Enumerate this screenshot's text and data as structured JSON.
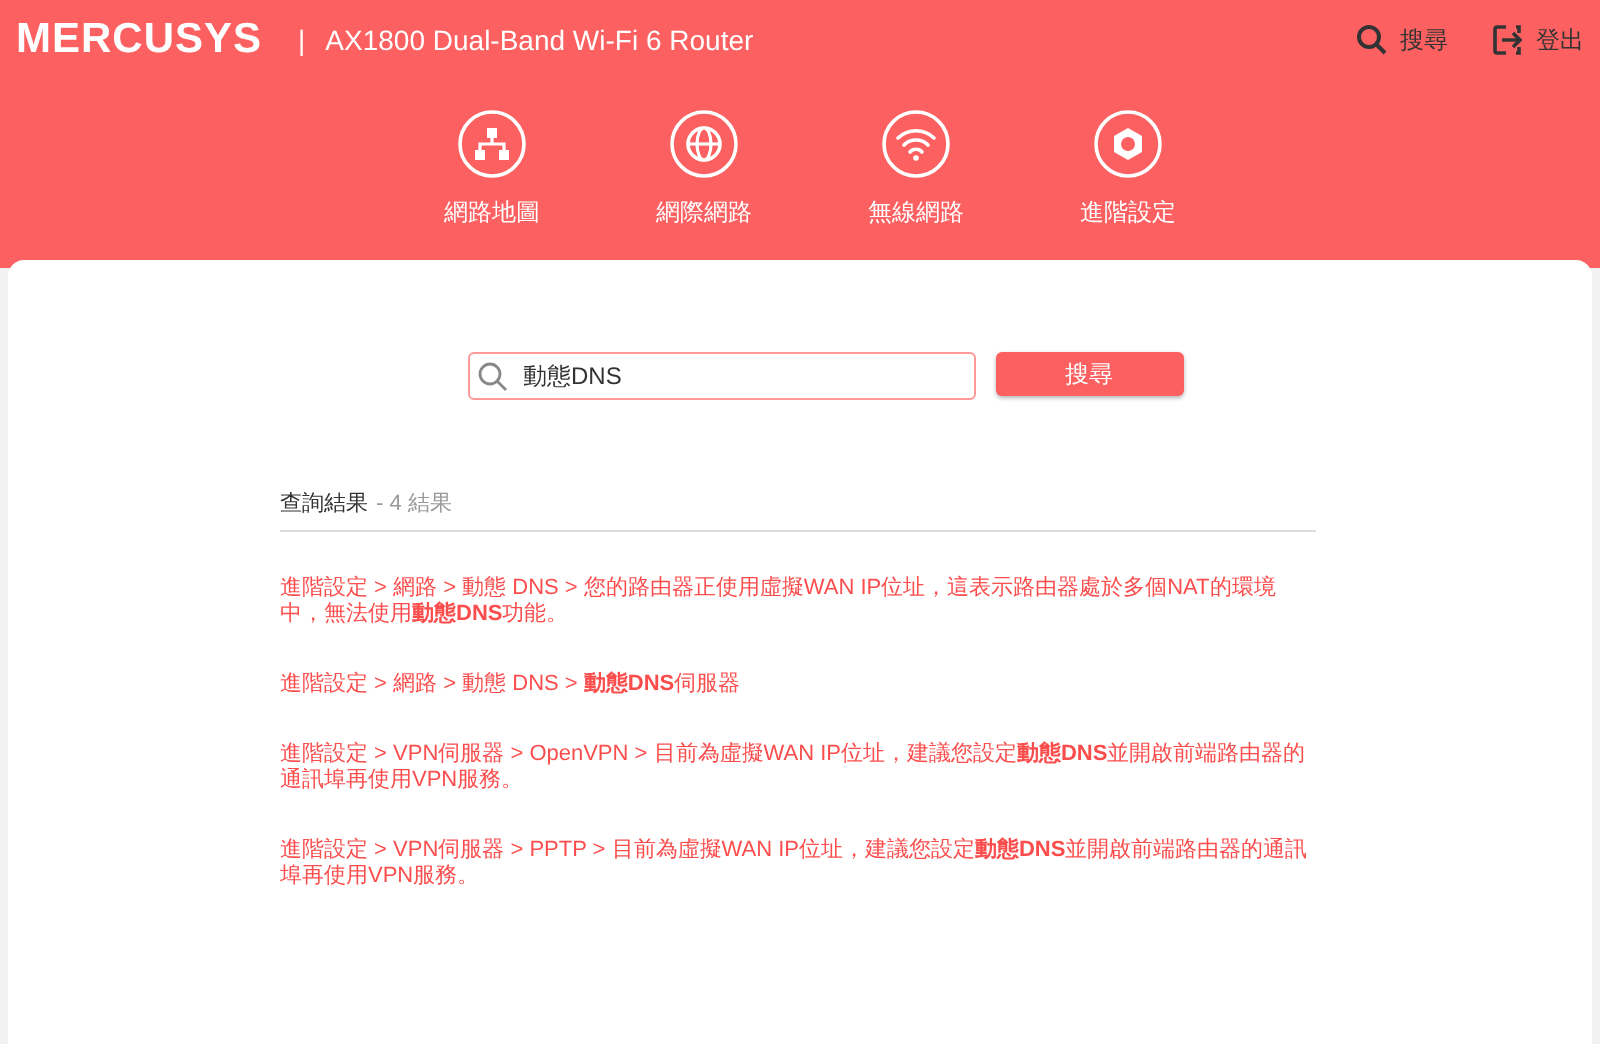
{
  "header": {
    "brand": "MERCUSYS",
    "separator": "|",
    "model": "AX1800 Dual-Band Wi-Fi 6 Router",
    "actions": [
      {
        "kind": "search",
        "label": "搜尋"
      },
      {
        "kind": "logout",
        "label": "登出"
      }
    ],
    "nav": [
      {
        "kind": "map",
        "label": "網路地圖"
      },
      {
        "kind": "internet",
        "label": "網際網路"
      },
      {
        "kind": "wireless",
        "label": "無線網路"
      },
      {
        "kind": "advanced",
        "label": "進階設定"
      }
    ]
  },
  "search": {
    "value": "動態DNS",
    "button": "搜尋"
  },
  "results": {
    "title": "查詢結果",
    "count": "- 4 結果",
    "items": [
      {
        "text": "進階設定 > 網路 > 動態 DNS > 您的路由器正使用虛擬WAN IP位址，這表示路由器處於多個NAT的環境中，無法使用**動態DNS**功能。"
      },
      {
        "text": "進階設定 > 網路 > 動態 DNS > **動態DNS**伺服器"
      },
      {
        "text": "進階設定 > VPN伺服器 > OpenVPN > 目前為虛擬WAN IP位址，建議您設定**動態DNS**並開啟前端路由器的通訊埠再使用VPN服務。"
      },
      {
        "text": "進階設定 > VPN伺服器 > PPTP > 目前為虛擬WAN IP位址，建議您設定**動態DNS**並開啟前端路由器的通訊埠再使用VPN服務。"
      }
    ]
  }
}
